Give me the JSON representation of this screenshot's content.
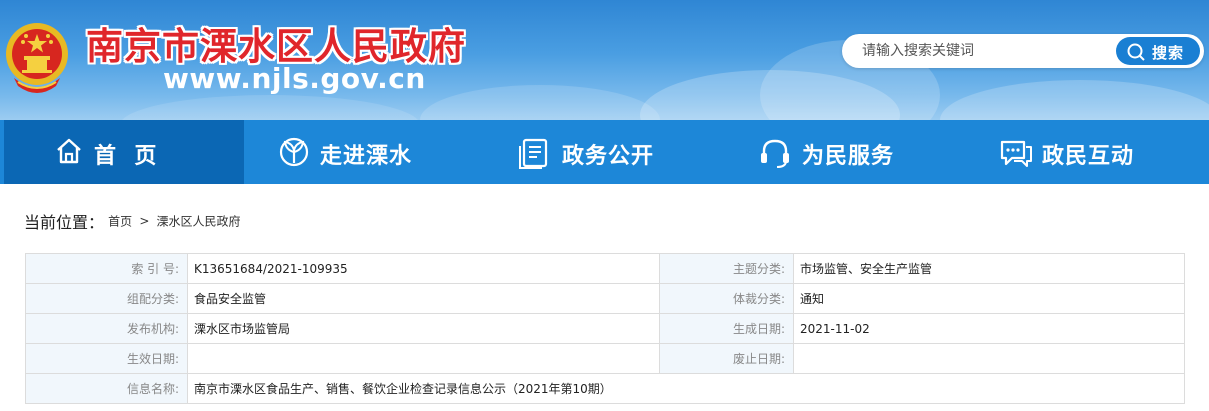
{
  "header": {
    "site_title": "南京市溧水区人民政府",
    "site_url": "www.njls.gov.cn",
    "search": {
      "placeholder": "请输入搜索关键词",
      "button_label": "搜索"
    }
  },
  "nav": {
    "items": [
      {
        "label": "首  页",
        "icon": "home-icon",
        "active": true
      },
      {
        "label": "走进溧水",
        "icon": "leaf-emblem-icon",
        "active": false
      },
      {
        "label": "政务公开",
        "icon": "document-icon",
        "active": false
      },
      {
        "label": "为民服务",
        "icon": "headset-icon",
        "active": false
      },
      {
        "label": "政民互动",
        "icon": "chat-bubbles-icon",
        "active": false
      }
    ]
  },
  "breadcrumb": {
    "label": "当前位置：",
    "items": [
      "首页",
      "溧水区人民政府"
    ],
    "separator": ">"
  },
  "info": {
    "rows": [
      {
        "label1": "索 引 号:",
        "value1": "K13651684/2021-109935",
        "label2": "主题分类:",
        "value2": "市场监管、安全生产监管"
      },
      {
        "label1": "组配分类:",
        "value1": "食品安全监管",
        "label2": "体裁分类:",
        "value2": "通知"
      },
      {
        "label1": "发布机构:",
        "value1": "溧水区市场监管局",
        "label2": "生成日期:",
        "value2": "2021-11-02"
      },
      {
        "label1": "生效日期:",
        "value1": "",
        "label2": "废止日期:",
        "value2": ""
      }
    ],
    "name_row": {
      "label": "信息名称:",
      "value": "南京市溧水区食品生产、销售、餐饮企业检查记录信息公示（2021年第10期）"
    }
  },
  "colors": {
    "header_blue": "#2f86d4",
    "nav_blue": "#1d87d8",
    "nav_active": "#0b67b4",
    "title_red": "#e0262b",
    "label_bg": "#f1f7fc"
  }
}
